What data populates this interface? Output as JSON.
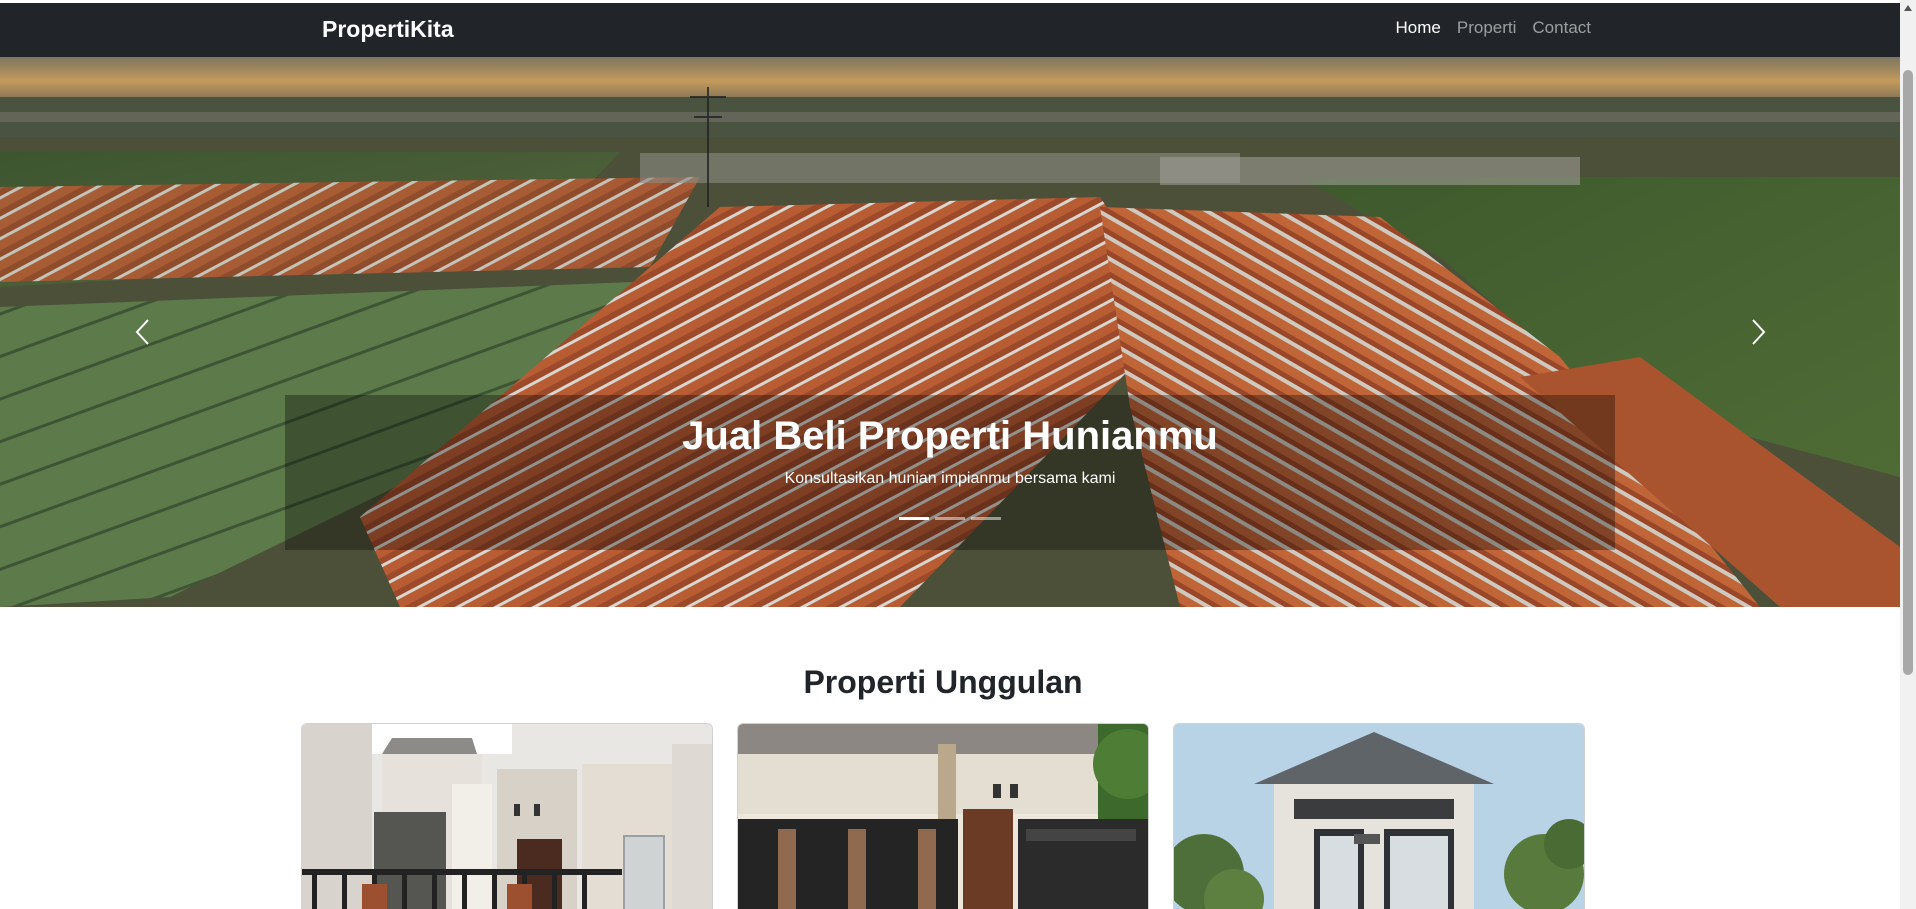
{
  "navbar": {
    "brand": "PropertiKita",
    "links": [
      {
        "label": "Home",
        "active": true
      },
      {
        "label": "Properti",
        "active": false
      },
      {
        "label": "Contact",
        "active": false
      }
    ]
  },
  "hero": {
    "title": "Jual Beli Properti Hunianmu",
    "subtitle": "Konsultasikan hunian impianmu bersama kami",
    "slide_count": 3,
    "active_slide": 1,
    "prev_icon": "chevron-left-icon",
    "next_icon": "chevron-right-icon"
  },
  "featured": {
    "title": "Properti Unggulan"
  },
  "colors": {
    "navbar_bg": "#212529",
    "text_dark": "#212529",
    "roof": "#b5532f"
  }
}
